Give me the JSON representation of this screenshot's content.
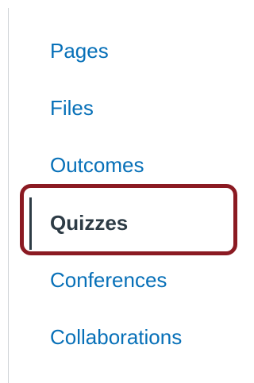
{
  "course_nav": {
    "items": [
      {
        "label": "Pages"
      },
      {
        "label": "Files"
      },
      {
        "label": "Outcomes"
      },
      {
        "label": "Quizzes",
        "active": true
      },
      {
        "label": "Conferences"
      },
      {
        "label": "Collaborations"
      }
    ]
  },
  "colors": {
    "link": "#0770b8",
    "active_text": "#2d3b45",
    "highlight_border": "#8b1a22"
  }
}
